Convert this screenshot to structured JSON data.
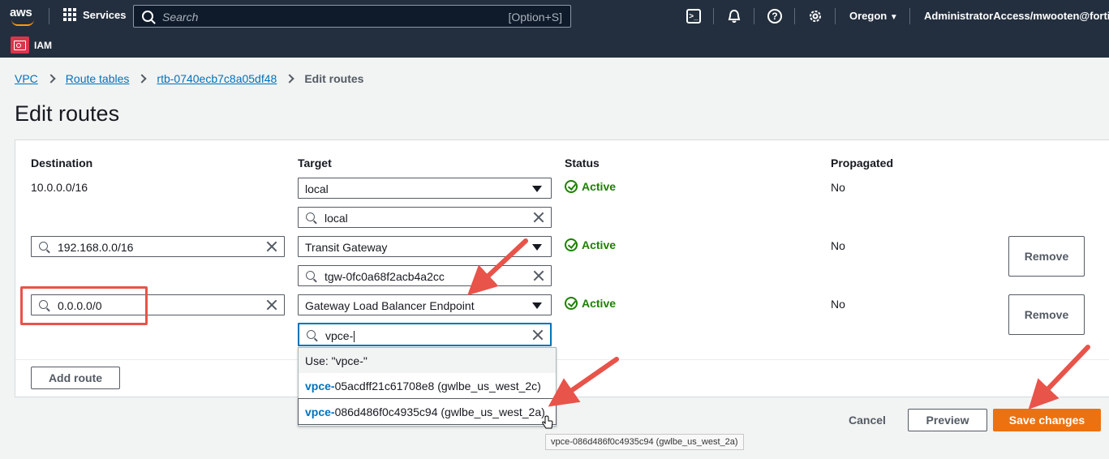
{
  "topnav": {
    "logo": "aws",
    "services_label": "Services",
    "search_placeholder": "Search",
    "search_shortcut": "[Option+S]",
    "region": "Oregon",
    "account": "AdministratorAccess/mwooten@fortinet.c",
    "icons": [
      "cloudshell-icon",
      "bell-icon",
      "help-icon",
      "gear-icon"
    ]
  },
  "service_bar": {
    "label": "IAM"
  },
  "breadcrumb": {
    "items": [
      "VPC",
      "Route tables",
      "rtb-0740ecb7c8a05df48"
    ],
    "current": "Edit routes"
  },
  "page_title": "Edit routes",
  "table": {
    "headers": {
      "destination": "Destination",
      "target": "Target",
      "status": "Status",
      "propagated": "Propagated"
    },
    "rows": [
      {
        "destination": "10.0.0.0/16",
        "target": "local",
        "target_search": "local",
        "status": "Active",
        "propagated": "No"
      },
      {
        "destination": "192.168.0.0/16",
        "target": "Transit Gateway",
        "target_search": "tgw-0fc0a68f2acb4a2cc",
        "status": "Active",
        "propagated": "No",
        "remove": "Remove"
      },
      {
        "destination": "0.0.0.0/0",
        "target": "Gateway Load Balancer Endpoint",
        "target_search": "vpce-",
        "status": "Active",
        "propagated": "No",
        "remove": "Remove"
      }
    ],
    "add_route": "Add route"
  },
  "dropdown": {
    "use_option": "Use: \"vpce-\"",
    "options": [
      {
        "match": "vpce-",
        "rest": "05acdff21c61708e8 (gwlbe_us_west_2c)"
      },
      {
        "match": "vpce-",
        "rest": "086d486f0c4935c94 (gwlbe_us_west_2a)"
      }
    ]
  },
  "tooltip": "vpce-086d486f0c4935c94 (gwlbe_us_west_2a)",
  "actions": {
    "cancel": "Cancel",
    "preview": "Preview",
    "save": "Save changes"
  },
  "colors": {
    "nav": "#232f3e",
    "accent": "#ec7211",
    "link": "#0073bb",
    "success": "#1d8102",
    "annotation": "#e8534a"
  }
}
